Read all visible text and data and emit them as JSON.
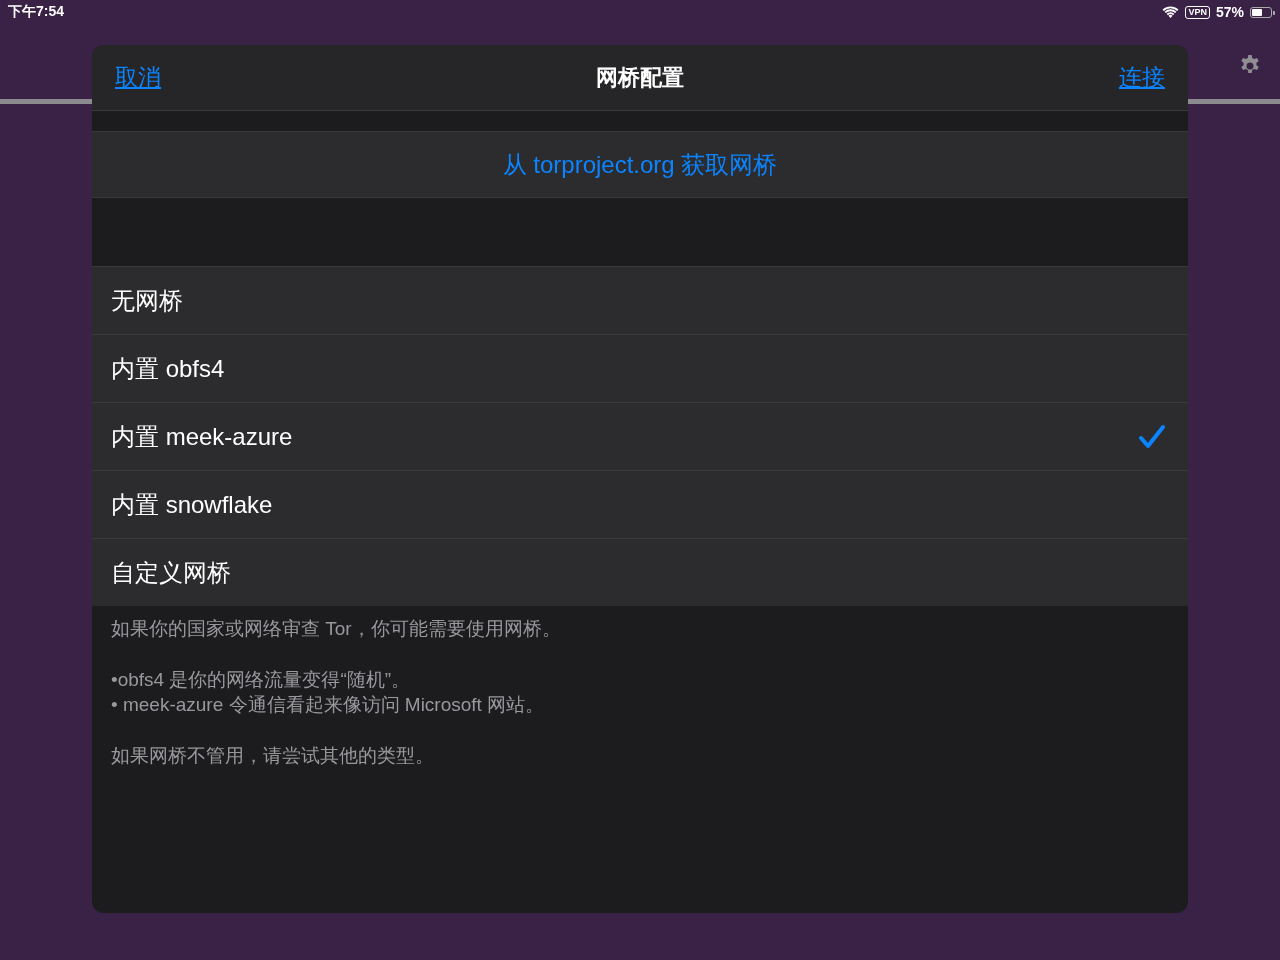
{
  "status_bar": {
    "time": "下午7:54",
    "vpn": "VPN",
    "battery": "57%"
  },
  "dialog": {
    "title": "网桥配置",
    "cancel": "取消",
    "confirm": "连接",
    "get_bridges": "从 torproject.org 获取网桥",
    "options": [
      {
        "label": "无网桥",
        "selected": false
      },
      {
        "label": "内置 obfs4",
        "selected": false
      },
      {
        "label": "内置 meek-azure",
        "selected": true
      },
      {
        "label": "内置 snowflake",
        "selected": false
      },
      {
        "label": "自定义网桥",
        "selected": false
      }
    ],
    "footer": [
      [
        "如果你的国家或网络审查 Tor，你可能需要使用网桥。"
      ],
      [
        "•obfs4 是你的网络流量变得“随机”。",
        "• meek-azure 令通信看起来像访问 Microsoft 网站。"
      ],
      [
        "如果网桥不管用，请尝试其他的类型。"
      ]
    ]
  }
}
